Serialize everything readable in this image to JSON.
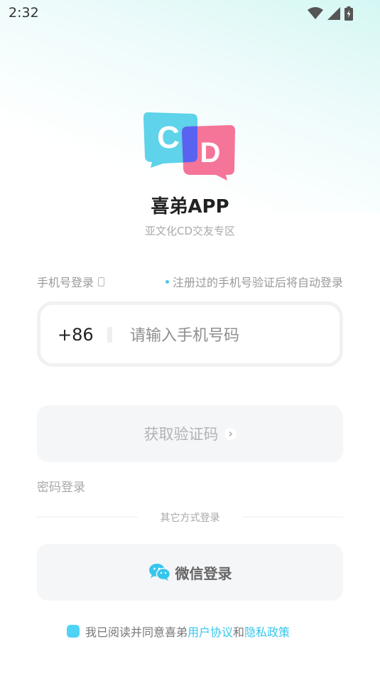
{
  "status_bar": {
    "time": "2:32"
  },
  "app": {
    "name": "喜弟APP",
    "subtitle": "亚文化CD交友专区",
    "logo_letters": [
      "C",
      "D"
    ]
  },
  "login": {
    "phone_label": "手机号登录",
    "auto_tip": "注册过的手机号验证后将自动登录",
    "country_code": "+86",
    "phone_placeholder": "请输入手机号码",
    "get_code_label": "获取验证码",
    "password_login": "密码登录",
    "other_methods": "其它方式登录",
    "wechat_login": "微信登录"
  },
  "agreement": {
    "prefix": "我已阅读并同意喜弟",
    "user_agreement": "用户协议",
    "and": "和",
    "privacy_policy": "隐私政策"
  },
  "colors": {
    "accent": "#36c6ec",
    "logo_cyan": "#5ed3ea",
    "logo_pink": "#f57598",
    "logo_overlap": "#5a63f0"
  },
  "icons": [
    "wifi-icon",
    "signal-icon",
    "battery-icon",
    "phone-icon",
    "chevron-right-icon",
    "wechat-icon"
  ]
}
